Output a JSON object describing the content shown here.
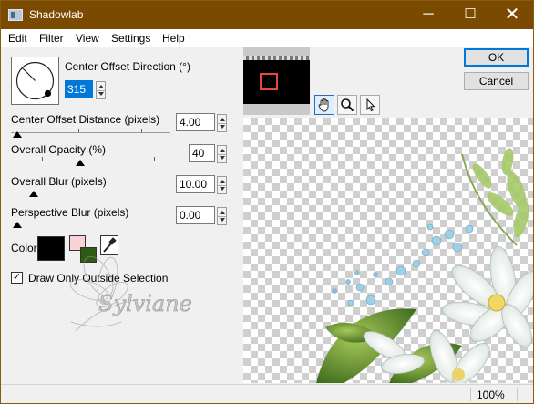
{
  "window": {
    "title": "Shadowlab",
    "minimize_glyph": "─",
    "maximize_glyph": "☐",
    "close_glyph": "✕"
  },
  "menu": [
    "Edit",
    "Filter",
    "View",
    "Settings",
    "Help"
  ],
  "controls": {
    "direction": {
      "label": "Center Offset Direction (°)",
      "value": "315"
    },
    "distance": {
      "label": "Center Offset Distance (pixels)",
      "value": "4.00"
    },
    "opacity": {
      "label": "Overall Opacity (%)",
      "value": "40"
    },
    "blur": {
      "label": "Overall Blur (pixels)",
      "value": "10.00"
    },
    "perspective": {
      "label": "Perspective Blur (pixels)",
      "value": "0.00"
    },
    "color": {
      "label": "Color",
      "primary": "#000000",
      "secondary_back": "#f7d3d8",
      "secondary_front": "#2f5a12"
    },
    "outside": {
      "label": "Draw Only Outside Selection",
      "checked": true,
      "check_glyph": "✓"
    }
  },
  "watermark": {
    "text": "Sylviane"
  },
  "buttons": {
    "ok": "OK",
    "cancel": "Cancel"
  },
  "tools": [
    "hand-icon",
    "zoom-icon",
    "pointer-icon"
  ],
  "status": {
    "zoom": "100%"
  },
  "colors": {
    "titlebar": "#7a4a00",
    "accent": "#0078d7",
    "selection_rect": "#e8463e"
  }
}
